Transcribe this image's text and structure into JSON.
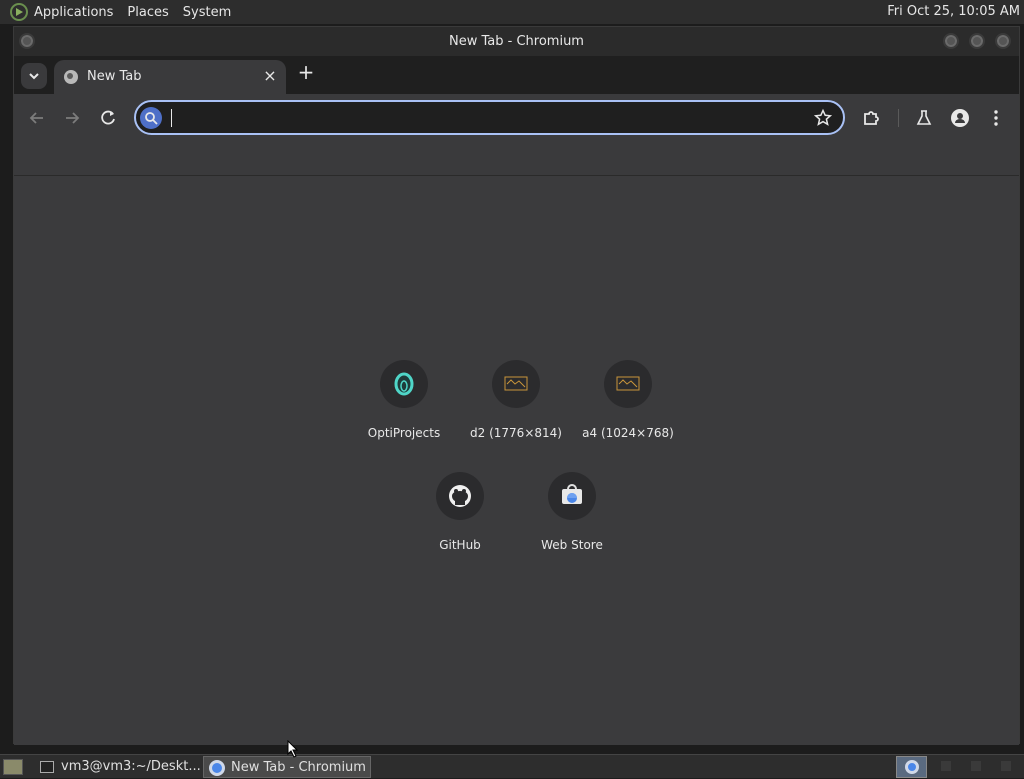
{
  "top_panel": {
    "menus": [
      "Applications",
      "Places",
      "System"
    ],
    "clock": "Fri Oct 25, 10:05 AM"
  },
  "window": {
    "title": "New Tab - Chromium"
  },
  "tabs": [
    {
      "title": "New Tab",
      "close": "×"
    }
  ],
  "new_tab_label": "+",
  "omnibox": {
    "value": "",
    "placeholder": ""
  },
  "shortcuts": [
    {
      "label": "OptiProjects",
      "icon": "optiprojects-icon"
    },
    {
      "label": "d2 (1776×814)",
      "icon": "site-thumbnail-icon"
    },
    {
      "label": "a4 (1024×768)",
      "icon": "site-thumbnail-icon"
    },
    {
      "label": "GitHub",
      "icon": "github-icon"
    },
    {
      "label": "Web Store",
      "icon": "web-store-icon"
    }
  ],
  "taskbar": {
    "items": [
      {
        "label": "vm3@vm3:~/Deskt...",
        "icon": "terminal-icon"
      },
      {
        "label": "New Tab - Chromium",
        "icon": "chromium-icon"
      }
    ]
  },
  "colors": {
    "accent": "#a9c1f5",
    "content_bg": "#3b3b3d",
    "toolbar_bg": "#3a3a3c",
    "teal": "#4fd6c8",
    "thumb_orange": "#c9953a"
  }
}
